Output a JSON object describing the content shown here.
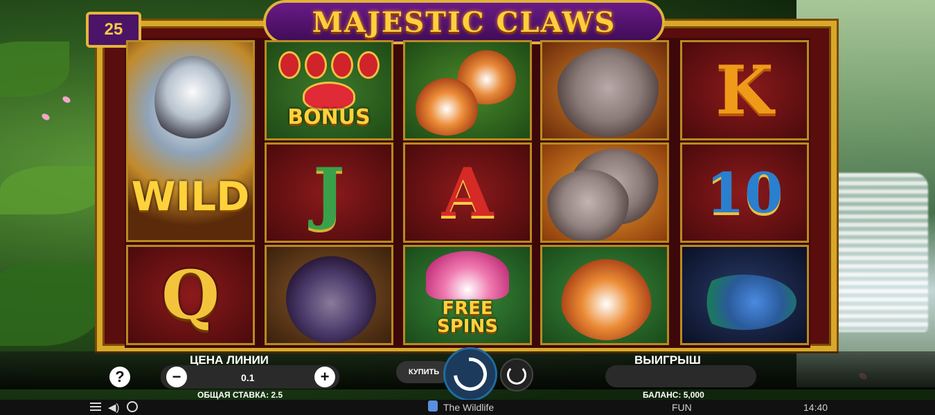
{
  "game": {
    "title": "MAJESTIC CLAWS",
    "lines": "25"
  },
  "symbols": {
    "wild": "WILD",
    "bonus": "BONUS",
    "free_spins_line1": "FREE",
    "free_spins_line2": "SPINS",
    "letter_j": "J",
    "letter_a": "A",
    "letter_k": "K",
    "letter_10": "10",
    "letter_q": "Q"
  },
  "controls": {
    "line_price_label": "ЦЕНА ЛИНИИ",
    "line_price_value": "0.1",
    "total_bet_label": "ОБЩАЯ СТАВКА: 2.5",
    "buy_label": "КУПИТЬ",
    "win_label": "ВЫИГРЫШ",
    "win_value": "",
    "balance_label": "БАЛАНС: 5,000",
    "help_label": "?",
    "minus_label": "−",
    "plus_label": "+"
  },
  "footer": {
    "brand": "The Wildlife",
    "mode": "FUN",
    "time": "14:40",
    "menu_icon": "hamburger-icon",
    "sound_icon": "speaker-icon",
    "turbo_icon": "turbo-icon"
  },
  "colors": {
    "frame_gold": "#d9a82a",
    "reel_bg": "#5a0d0d",
    "title_purple": "#4b1466",
    "spin_blue": "#1e6da3"
  }
}
